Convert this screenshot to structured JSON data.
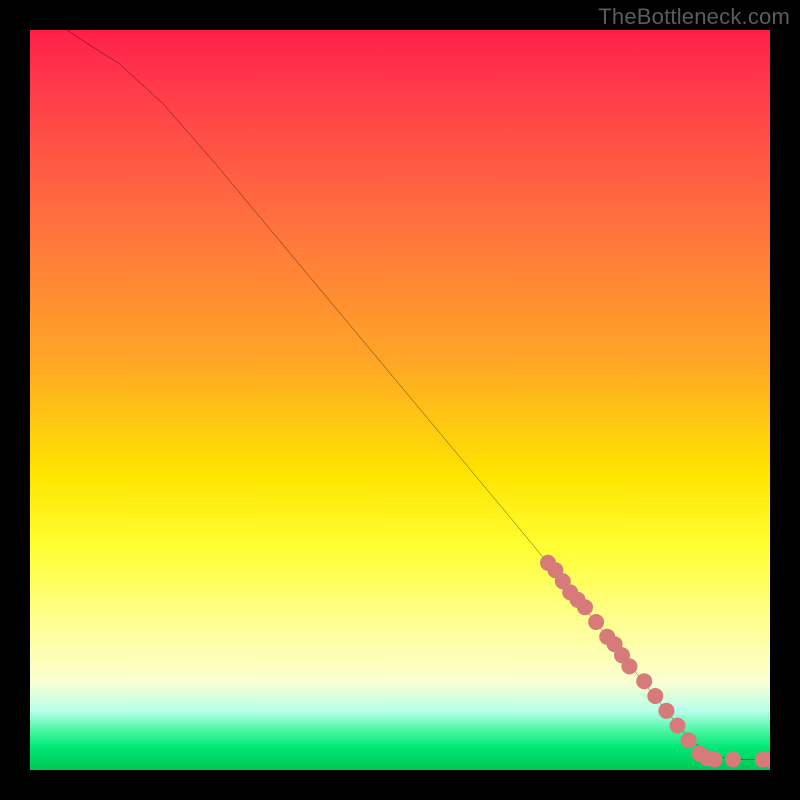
{
  "watermark": "TheBottleneck.com",
  "chart_data": {
    "type": "line",
    "title": "",
    "xlabel": "",
    "ylabel": "",
    "xlim": [
      0,
      100
    ],
    "ylim": [
      0,
      100
    ],
    "curve": {
      "x": [
        5,
        8,
        12,
        18,
        25,
        35,
        45,
        55,
        65,
        72,
        78,
        82,
        86,
        88,
        90,
        92,
        95,
        98,
        100
      ],
      "y": [
        100,
        98,
        95.5,
        90,
        82,
        70,
        58,
        46,
        34,
        25.5,
        18,
        13,
        8,
        5.5,
        3.5,
        2,
        1.4,
        1.4,
        1.4
      ]
    },
    "markers": {
      "color": "#d77a7a",
      "radius_px": 8,
      "points": [
        {
          "x": 70,
          "y": 28
        },
        {
          "x": 71,
          "y": 27
        },
        {
          "x": 72,
          "y": 25.5
        },
        {
          "x": 73,
          "y": 24
        },
        {
          "x": 74,
          "y": 23
        },
        {
          "x": 75,
          "y": 22
        },
        {
          "x": 76.5,
          "y": 20
        },
        {
          "x": 78,
          "y": 18
        },
        {
          "x": 79,
          "y": 17
        },
        {
          "x": 80,
          "y": 15.5
        },
        {
          "x": 81,
          "y": 14
        },
        {
          "x": 83,
          "y": 12
        },
        {
          "x": 84.5,
          "y": 10
        },
        {
          "x": 86,
          "y": 8
        },
        {
          "x": 87.5,
          "y": 6
        },
        {
          "x": 89,
          "y": 4
        },
        {
          "x": 90.5,
          "y": 2.2
        },
        {
          "x": 91.5,
          "y": 1.6
        },
        {
          "x": 92.5,
          "y": 1.4
        },
        {
          "x": 95,
          "y": 1.4
        },
        {
          "x": 99,
          "y": 1.4
        },
        {
          "x": 100,
          "y": 1.4
        }
      ]
    },
    "background": "heatmap-gradient",
    "legend": null
  }
}
